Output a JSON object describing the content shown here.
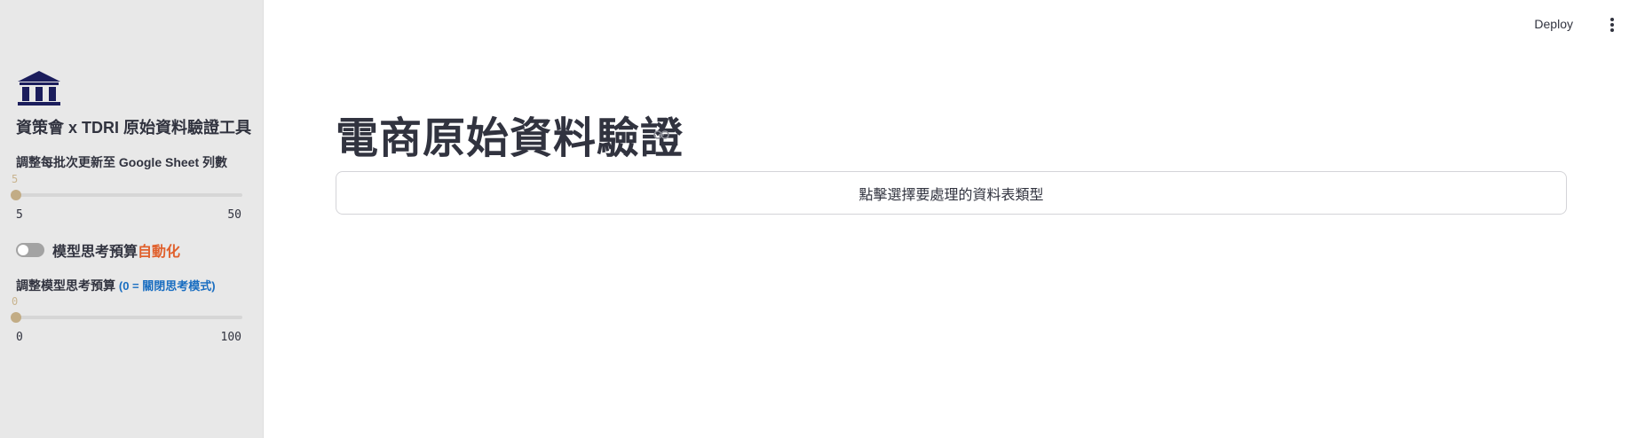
{
  "sidebar": {
    "logo_icon": "institution-building-icon",
    "title": "資策會 x TDRI 原始資料驗證工具",
    "rows_slider": {
      "label": "調整每批次更新至 Google Sheet 列數",
      "value": "5",
      "min": "5",
      "max": "50"
    },
    "auto_toggle": {
      "label": "模型思考預算",
      "label_accent": "自動化",
      "checked": false
    },
    "budget_slider": {
      "label": "調整模型思考預算",
      "hint": "(0 = 關閉思考模式)",
      "value": "0",
      "min": "0",
      "max": "100"
    }
  },
  "header": {
    "deploy_label": "Deploy",
    "menu_icon": "vertical-dots-icon"
  },
  "main": {
    "title": "電商原始資料驗證",
    "anchor_icon": "link-icon",
    "select_button": "點擊選擇要處理的資料表類型"
  },
  "colors": {
    "sidebar_bg": "#e8e8e8",
    "logo": "#1b1d5c",
    "accent_orange": "#e0602c",
    "hint_blue": "#1a6ec1",
    "slider_thumb": "#c2ac85"
  }
}
